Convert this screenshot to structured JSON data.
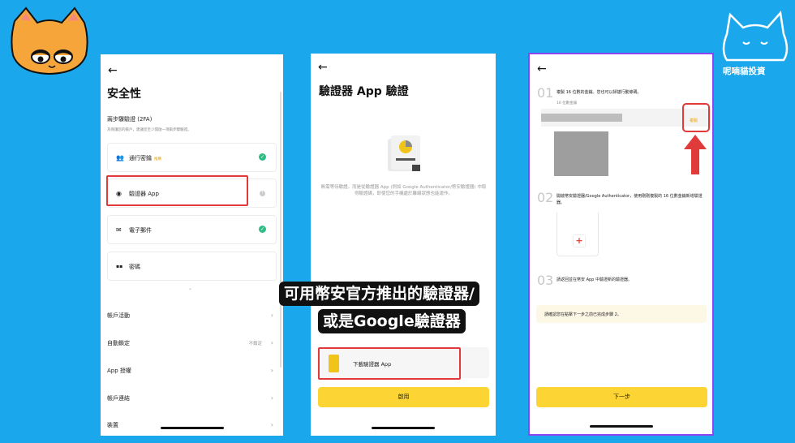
{
  "caption": {
    "line1": "可用幣安官方推出的驗證器/",
    "line2": "或是Google驗證器"
  },
  "brand": "呢喃貓投資",
  "phone1": {
    "back": "←",
    "title": "安全性",
    "section": "兩步驟驗證 (2FA)",
    "section_desc": "為保護您的帳戶，建議您至少開啟一項兩步驟驗證。",
    "items": [
      {
        "label": "通行密鑰",
        "badge": "推薦",
        "icon": "people-icon",
        "glyph": "👥"
      },
      {
        "label": "驗證器 App",
        "icon": "authenticator-icon",
        "glyph": "◉"
      },
      {
        "label": "電子郵件",
        "icon": "mail-icon",
        "glyph": "✉"
      },
      {
        "label": "密碼",
        "icon": "password-icon",
        "glyph": "▪▪"
      }
    ],
    "more": "⌄",
    "rows": [
      {
        "label": "帳戶活動"
      },
      {
        "label": "自動鎖定",
        "value": "不鎖定"
      },
      {
        "label": "App 授權"
      },
      {
        "label": "帳戶連結"
      },
      {
        "label": "裝置"
      }
    ]
  },
  "phone2": {
    "back": "←",
    "title": "驗證器 App 驗證",
    "desc": "無需等待驗證。而是從驗證器 App (例如 Google Authenticator/幣安驗證器) 中取得驗證碼，即使您的手機處於離線狀態也能運作。",
    "download_label": "下載驗證器 App",
    "enable_button": "啟用"
  },
  "phone3": {
    "back": "←",
    "steps": [
      {
        "num": "01",
        "text": "複製 16 位數的金鑰。您也可以掃描行動條碼。"
      },
      {
        "num": "02",
        "text": "開啟幣安驗證器/Google Authenticator，使用剛剛複製的 16 位數金鑰新增驗證器。"
      },
      {
        "num": "03",
        "text": "請返回並在幣安 App 中驗證新的驗證器。"
      }
    ],
    "key_label": "16 位數金鑰",
    "copy_label": "複製",
    "notice": "請確認您在點擊下一步之前已完成步驟 2。",
    "next_button": "下一步"
  },
  "colors": {
    "background": "#1aa7ec",
    "binance_yellow": "#fcd535",
    "highlight_red": "#e03a3a",
    "success_green": "#2ebd85"
  }
}
